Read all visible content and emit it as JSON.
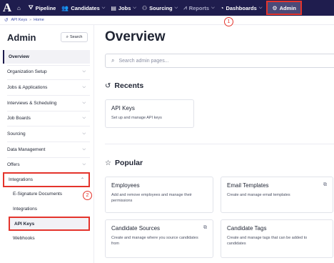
{
  "topnav": {
    "logo": "A",
    "items": [
      {
        "label": "",
        "icon": "⌂"
      },
      {
        "label": "Pipeline",
        "icon": "⛛"
      },
      {
        "label": "Candidates",
        "icon": "👥"
      },
      {
        "label": "Jobs",
        "icon": "▤"
      },
      {
        "label": "Sourcing",
        "icon": "⚇"
      },
      {
        "label": "Reports",
        "icon": "⩘"
      },
      {
        "label": "Dashboards",
        "icon": "◔"
      },
      {
        "label": "Admin",
        "icon": "⚙"
      }
    ]
  },
  "breadcrumb": {
    "current": "API Keys",
    "separator": "»",
    "parent": "Home"
  },
  "annotations": {
    "step1": "1",
    "step2": "2"
  },
  "sidebar": {
    "title": "Admin",
    "search_label": "Search",
    "items": [
      {
        "label": "Overview"
      },
      {
        "label": "Organization Setup"
      },
      {
        "label": "Jobs & Applications"
      },
      {
        "label": "Interviews & Scheduling"
      },
      {
        "label": "Job Boards"
      },
      {
        "label": "Sourcing"
      },
      {
        "label": "Data Management"
      },
      {
        "label": "Offers"
      },
      {
        "label": "Integrations"
      }
    ],
    "integrations_sub": [
      {
        "label": "E-Signature Documents"
      },
      {
        "label": "Integrations"
      },
      {
        "label": "API Keys"
      },
      {
        "label": "Webhooks"
      }
    ]
  },
  "main": {
    "title": "Overview",
    "search_placeholder": "Search admin pages...",
    "recents_title": "Recents",
    "recents": [
      {
        "title": "API Keys",
        "desc": "Set up and manage API keys"
      }
    ],
    "popular_title": "Popular",
    "popular": [
      {
        "title": "Employees",
        "desc": "Add and remove employees and manage their permissions"
      },
      {
        "title": "Email Templates",
        "desc": "Create and manage email templates"
      },
      {
        "title": "Candidate Sources",
        "desc": "Create and manage where you source candidates from"
      },
      {
        "title": "Candidate Tags",
        "desc": "Create and manage tags that can be added to candidates"
      }
    ]
  },
  "colors": {
    "nav_bg": "#1f1d4e",
    "highlight": "#e4342c",
    "link": "#3b4ba8"
  }
}
